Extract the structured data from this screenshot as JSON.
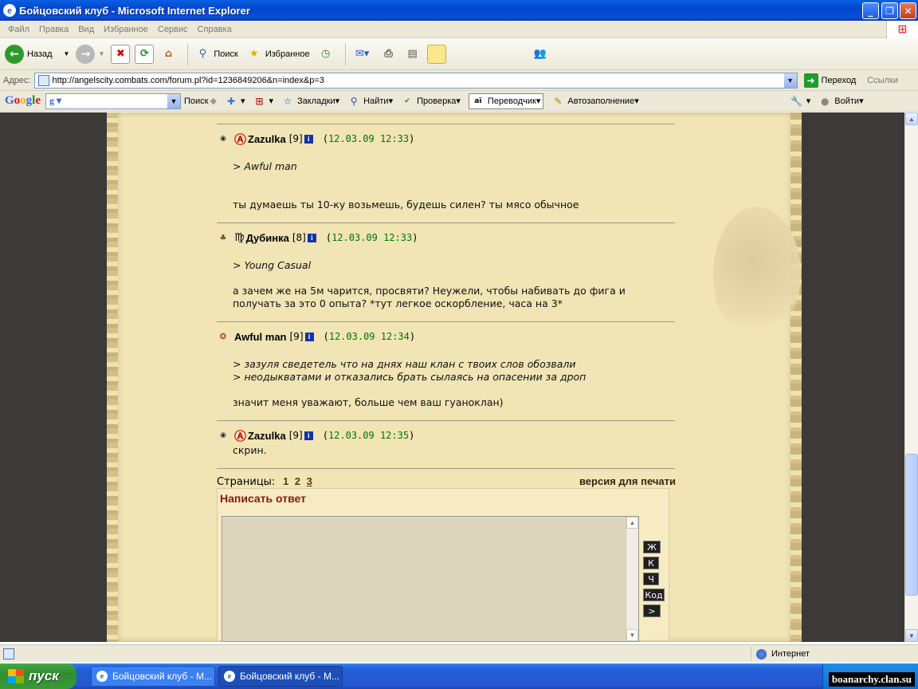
{
  "window": {
    "title": "Бойцовский клуб - Microsoft Internet Explorer"
  },
  "menu": [
    "Файл",
    "Правка",
    "Вид",
    "Избранное",
    "Сервис",
    "Справка"
  ],
  "toolbar": {
    "back": "Назад",
    "search": "Поиск",
    "favorites": "Избранное"
  },
  "address": {
    "label": "Адрес:",
    "url": "http://angelscity.combats.com/forum.pl?id=1236849206&n=index&p=3",
    "go": "Переход",
    "links": "Ссылки"
  },
  "google": {
    "logo": "Google",
    "search": "Поиск",
    "bookmarks": "Закладки",
    "find": "Найти",
    "spell": "Проверка",
    "translate": "Переводчик",
    "autofill": "Автозаполнение",
    "signin": "Войти"
  },
  "posts": [
    {
      "user": "Zazulka",
      "level": "[9]",
      "date": "12.03.09 12:33",
      "quote": [
        "> Awful man"
      ],
      "text": [
        "ты думаешь ты 10-ку возьмешь, будешь силен? ты мясо обычное"
      ]
    },
    {
      "user": "Дубинка",
      "level": "[8]",
      "date": "12.03.09 12:33",
      "quote": [
        "> Young Casual"
      ],
      "text": [
        "а зачем же на 5м чарится, просвяти? Неужели, чтобы набивать до фига и",
        "получать за это 0 опыта? *тут легкое оскорбление, часа на 3*"
      ]
    },
    {
      "user": "Awful man",
      "level": "[9]",
      "date": "12.03.09 12:34",
      "quote": [
        "> зазуля сведетель что на днях наш клан с твоих слов обозвали",
        "> неодыкватами и отказались брать сылаясь на опасении за дроп"
      ],
      "text": [
        "значит меня уважают, больше чем ваш гуаноклан)"
      ]
    },
    {
      "user": "Zazulka",
      "level": "[9]",
      "date": "12.03.09 12:35",
      "quote": [],
      "text": [
        "скрин."
      ]
    }
  ],
  "pages": {
    "label": "Страницы:",
    "list": [
      "1",
      "2",
      "3"
    ],
    "current": "3",
    "print": "версия для печати"
  },
  "reply": {
    "title": "Написать ответ",
    "buttons": [
      "Ж",
      "К",
      "Ч",
      "Код",
      ">"
    ]
  },
  "status": {
    "zone": "Интернет"
  },
  "taskbar": {
    "start": "пуск",
    "tasks": [
      "Бойцовский клуб - M...",
      "Бойцовский клуб - M..."
    ]
  },
  "watermark": "boanarchy.clan.su",
  "colors": {
    "date": "#007700",
    "replyTitle": "#8a1a0a",
    "parchment": "#f1e4b5"
  }
}
